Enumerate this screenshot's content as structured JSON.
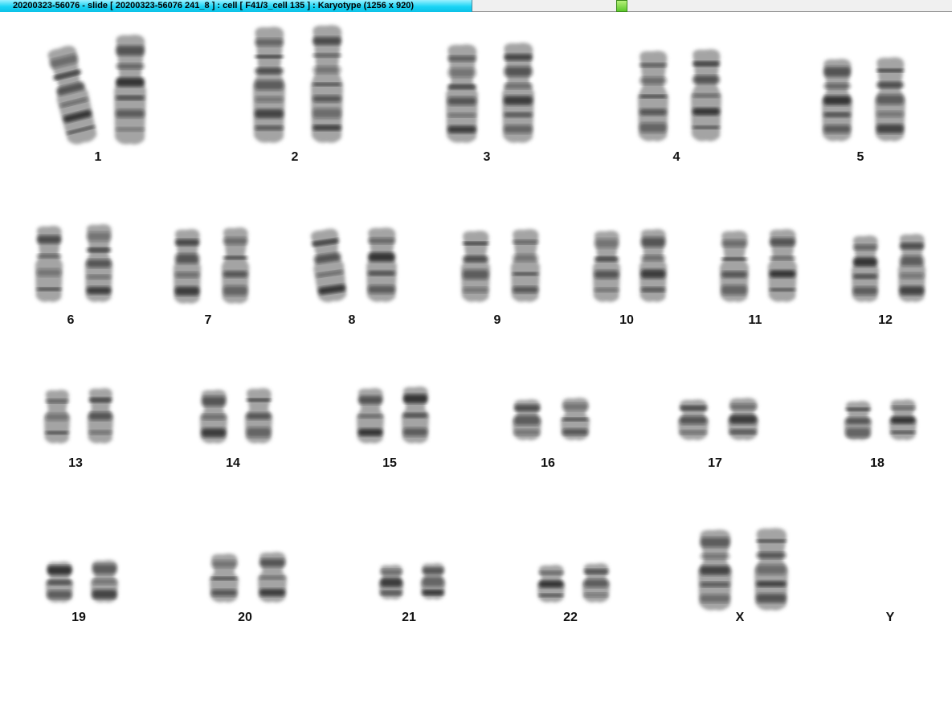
{
  "window": {
    "title": "20200323-56076 - slide [ 20200323-56076 241_8 ] : cell [ F41/3_cell 135 ] : Karyotype  (1256 x 920)"
  },
  "colors": {
    "title_bar": "#1ad4f5",
    "status_indicator": "#5cc82a",
    "chromatin": "#1a1a1a"
  },
  "karyotype": {
    "chromosomes": [
      {
        "label": "1",
        "present": true
      },
      {
        "label": "2",
        "present": true
      },
      {
        "label": "3",
        "present": true
      },
      {
        "label": "4",
        "present": true
      },
      {
        "label": "5",
        "present": true
      },
      {
        "label": "6",
        "present": true
      },
      {
        "label": "7",
        "present": true
      },
      {
        "label": "8",
        "present": true
      },
      {
        "label": "9",
        "present": true
      },
      {
        "label": "10",
        "present": true
      },
      {
        "label": "11",
        "present": true
      },
      {
        "label": "12",
        "present": true
      },
      {
        "label": "13",
        "present": true
      },
      {
        "label": "14",
        "present": true
      },
      {
        "label": "15",
        "present": true
      },
      {
        "label": "16",
        "present": true
      },
      {
        "label": "17",
        "present": true
      },
      {
        "label": "18",
        "present": true
      },
      {
        "label": "19",
        "present": true
      },
      {
        "label": "20",
        "present": true
      },
      {
        "label": "21",
        "present": true
      },
      {
        "label": "22",
        "present": true
      },
      {
        "label": "X",
        "present": true
      },
      {
        "label": "Y",
        "present": false
      }
    ]
  }
}
